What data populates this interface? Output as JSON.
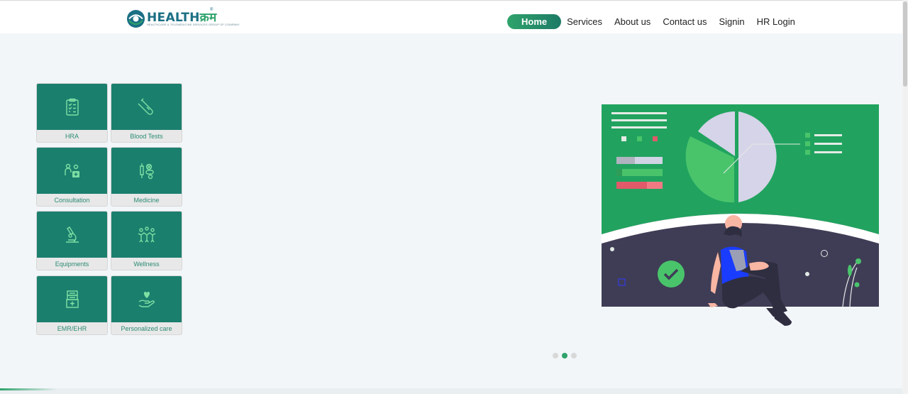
{
  "brand": {
    "name_latin": "HEALTH",
    "name_devanagari": "क्रम",
    "tagline": "HEALTHCARE & TELEMEDICINE SERVICES GROUP OF COMPANY",
    "reg": "®"
  },
  "nav": {
    "items": [
      {
        "label": "Home",
        "active": true
      },
      {
        "label": "Services"
      },
      {
        "label": "About us"
      },
      {
        "label": "Contact us"
      },
      {
        "label": "Signin"
      },
      {
        "label": "HR Login"
      }
    ]
  },
  "services": [
    {
      "label": "HRA",
      "icon": "clipboard-checklist-icon"
    },
    {
      "label": "Blood Tests",
      "icon": "test-tube-icon"
    },
    {
      "label": "Consultation",
      "icon": "doctor-consultation-icon"
    },
    {
      "label": "Medicine",
      "icon": "medicine-pills-icon"
    },
    {
      "label": "Equipments",
      "icon": "microscope-icon"
    },
    {
      "label": "Wellness",
      "icon": "wellness-people-icon"
    },
    {
      "label": "EMR/EHR",
      "icon": "medical-records-icon"
    },
    {
      "label": "Personalized care",
      "icon": "heart-hand-icon"
    }
  ],
  "carousel": {
    "slides": 3,
    "active_index": 1
  },
  "colors": {
    "brand_green": "#1b7f6e",
    "accent_green": "#2fa36b",
    "hero_green": "#21a35f",
    "hero_dark": "#3f3d56"
  }
}
